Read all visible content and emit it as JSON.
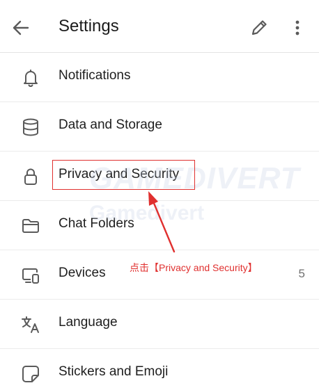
{
  "header": {
    "title": "Settings",
    "back_icon": "arrow-left-icon",
    "edit_icon": "pencil-icon",
    "more_icon": "more-vertical-icon"
  },
  "items": [
    {
      "label": "Notifications",
      "icon": "bell-icon"
    },
    {
      "label": "Data and Storage",
      "icon": "database-icon"
    },
    {
      "label": "Privacy and Security",
      "icon": "lock-icon"
    },
    {
      "label": "Chat Folders",
      "icon": "folder-icon"
    },
    {
      "label": "Devices",
      "icon": "devices-icon",
      "value": "5"
    },
    {
      "label": "Language",
      "icon": "translate-icon"
    },
    {
      "label": "Stickers and Emoji",
      "icon": "sticker-icon"
    }
  ],
  "annotation": {
    "text": "点击【Privacy and Security】",
    "color": "#e0302f"
  },
  "watermark": {
    "brand": "GAMEDIVERT",
    "sub": "Gamedivert"
  },
  "colors": {
    "text": "#1e1e1e",
    "icon": "#5a5a5a",
    "highlight": "#e0302f"
  }
}
